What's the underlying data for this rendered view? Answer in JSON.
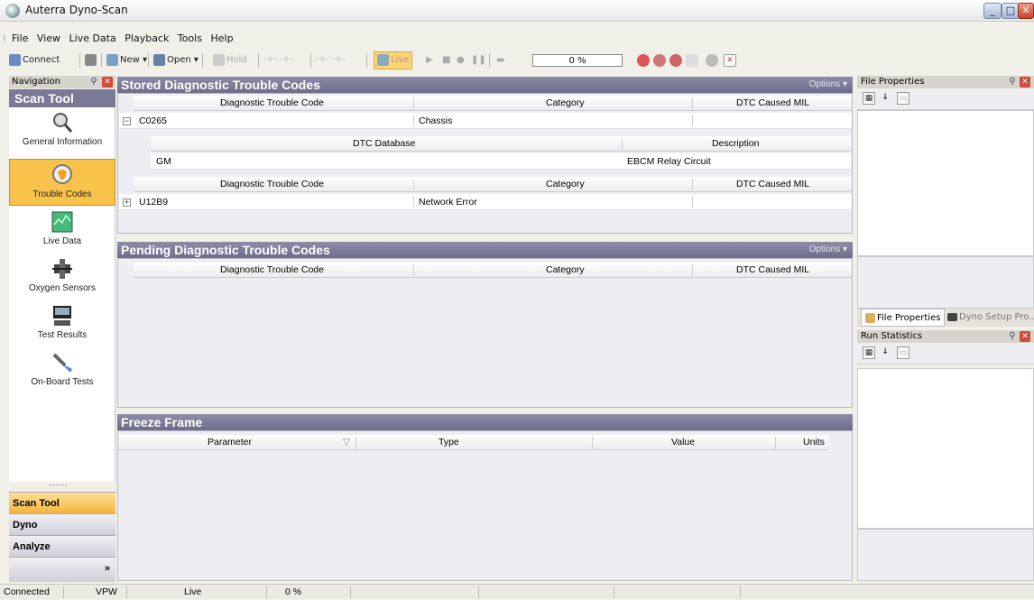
{
  "window": {
    "title": "Auterra Dyno-Scan"
  },
  "menu": [
    "File",
    "View",
    "Live Data",
    "Playback",
    "Tools",
    "Help"
  ],
  "toolbar": {
    "connect": "Connect",
    "new": "New",
    "open": "Open",
    "hold": "Hold",
    "live": "Live",
    "progress": "0 %"
  },
  "navigation": {
    "header": "Navigation",
    "title": "Scan Tool",
    "items": [
      {
        "label": "General Information",
        "icon": "magnifier-icon"
      },
      {
        "label": "Trouble Codes",
        "icon": "check-engine-icon",
        "selected": true
      },
      {
        "label": "Live Data",
        "icon": "live-data-icon"
      },
      {
        "label": "Oxygen Sensors",
        "icon": "oxygen-sensor-icon"
      },
      {
        "label": "Test Results",
        "icon": "test-results-icon"
      },
      {
        "label": "On-Board Tests",
        "icon": "on-board-tests-icon"
      }
    ],
    "grip": "........",
    "buttons": [
      "Scan Tool",
      "Dyno",
      "Analyze"
    ],
    "more": "»"
  },
  "stored": {
    "title": "Stored Diagnostic Trouble Codes",
    "options": "Options",
    "columns": [
      "Diagnostic Trouble Code",
      "Category",
      "DTC Caused MIL"
    ],
    "rows": [
      {
        "code": "C0265",
        "category": "Chassis",
        "mil": "",
        "expanded": "⊟",
        "sub": {
          "columns": [
            "DTC Database",
            "Description"
          ],
          "row": [
            "GM",
            "EBCM Relay Circuit"
          ]
        }
      },
      {
        "code": "U12B9",
        "category": "Network Error",
        "mil": "",
        "expanded": "⊞"
      }
    ]
  },
  "pending": {
    "title": "Pending Diagnostic Trouble Codes",
    "options": "Options",
    "columns": [
      "Diagnostic Trouble Code",
      "Category",
      "DTC Caused MIL"
    ]
  },
  "freeze": {
    "title": "Freeze Frame",
    "columns": [
      "Parameter",
      "Type",
      "Value",
      "Units"
    ],
    "sort_glyph": "▽"
  },
  "right": {
    "file_properties": "File Properties",
    "tabs": [
      "File Properties",
      "Dyno Setup Pro..."
    ],
    "run_statistics": "Run Statistics",
    "sort_az": "A↓Z"
  },
  "status": {
    "connection": "Connected",
    "protocol": "VPW",
    "mode": "Live",
    "progress": "0 %"
  },
  "colors": {
    "header": "#7b7a96",
    "selected": "#f9c24b",
    "close": "#d24a3a"
  }
}
